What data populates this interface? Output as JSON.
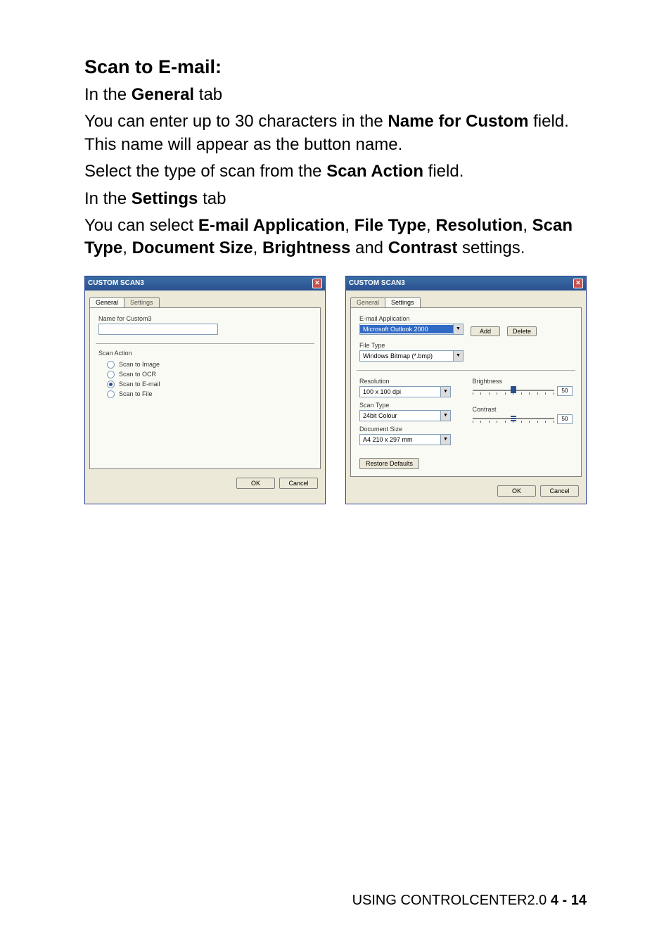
{
  "heading": "Scan to E-mail:",
  "p1_pre": "In the ",
  "p1_bold": "General",
  "p1_post": " tab",
  "p2_pre": "You can enter up to 30 characters in the ",
  "p2_bold": "Name for Custom",
  "p2_post": " field. This name will appear as the button name.",
  "p3_pre": "Select the type of scan from the ",
  "p3_bold": "Scan Action",
  "p3_post": " field.",
  "p4_pre": "In the ",
  "p4_bold": "Settings",
  "p4_post": " tab",
  "p5_pre": "You can select ",
  "p5_b1": "E-mail Application",
  "p5_s1": ", ",
  "p5_b2": "File Type",
  "p5_s2": ", ",
  "p5_b3": "Resolution",
  "p5_s3": ", ",
  "p5_b4": "Scan Type",
  "p5_s4": ", ",
  "p5_b5": "Document Size",
  "p5_s5": ", ",
  "p5_b6": "Brightness",
  "p5_s6": " and ",
  "p5_b7": "Contrast",
  "p5_s7": " settings.",
  "dialog1": {
    "title": "CUSTOM SCAN3",
    "tab_general": "General",
    "tab_settings": "Settings",
    "name_label": "Name for Custom3",
    "name_value": "",
    "scan_action": "Scan Action",
    "radio_image": "Scan to Image",
    "radio_ocr": "Scan to OCR",
    "radio_email": "Scan to E-mail",
    "radio_file": "Scan to File",
    "ok": "OK",
    "cancel": "Cancel"
  },
  "dialog2": {
    "title": "CUSTOM SCAN3",
    "tab_general": "General",
    "tab_settings": "Settings",
    "email_label": "E-mail Application",
    "email_value": "Microsoft Outlook 2000",
    "add": "Add",
    "delete": "Delete",
    "filetype_label": "File Type",
    "filetype_value": "Windows Bitmap (*.bmp)",
    "resolution_label": "Resolution",
    "resolution_value": "100 x 100 dpi",
    "scantype_label": "Scan Type",
    "scantype_value": "24bit Colour",
    "docsize_label": "Document Size",
    "docsize_value": "A4 210 x 297 mm",
    "brightness_label": "Brightness",
    "brightness_value": "50",
    "contrast_label": "Contrast",
    "contrast_value": "50",
    "restore": "Restore Defaults",
    "ok": "OK",
    "cancel": "Cancel"
  },
  "footer_text": "USING CONTROLCENTER2.0   ",
  "footer_page": "4 - 14"
}
